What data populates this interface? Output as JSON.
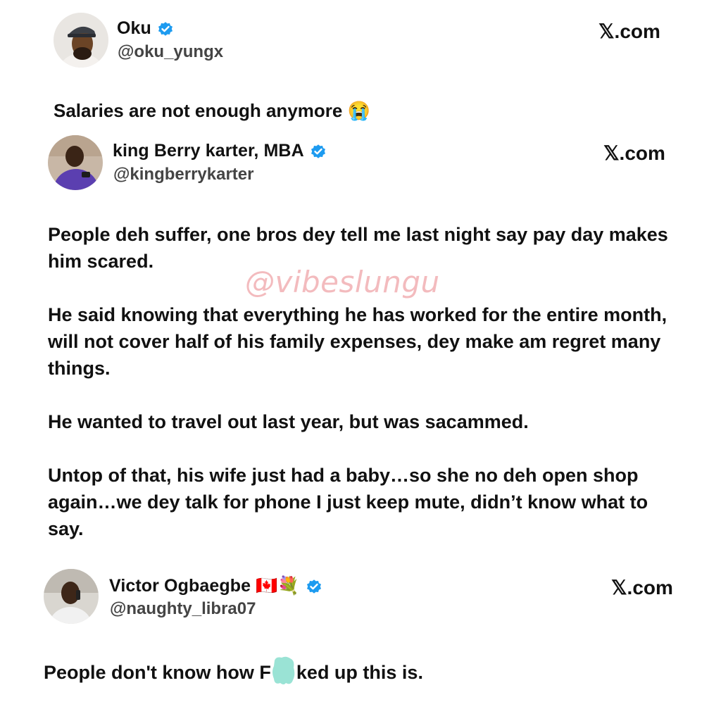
{
  "tweets": [
    {
      "name": "Oku",
      "handle": "@oku_yungx",
      "source": "𝕏.com",
      "text": "Salaries are not enough anymore 😭",
      "avatar_icon": "man-with-cap-avatar"
    },
    {
      "name": "king Berry karter, MBA",
      "handle": "@kingberrykarter",
      "source": "𝕏.com",
      "paragraphs": [
        "People deh suffer, one bros dey tell me last night say pay day makes him scared.",
        "He said knowing that everything he has worked for the entire month, will not cover half of his family expenses, dey make am regret many things.",
        "He wanted to travel out last year,  but was sacammed.",
        "Untop of that, his wife just had a baby…so she no deh open shop again…we dey talk for phone I just keep mute, didn’t know what to say."
      ],
      "avatar_icon": "man-in-purple-avatar"
    },
    {
      "name": "Victor Ogbaegbe 🇨🇦💐",
      "handle": "@naughty_libra07",
      "source": "𝕏.com",
      "text_before": "People don't know how F",
      "text_after": "ked up this is.",
      "avatar_icon": "man-on-phone-avatar"
    }
  ],
  "watermark": "@vibeslungu",
  "colors": {
    "verified_blue": "#1d9bf0",
    "watermark_pink": "#f2b0b3",
    "censor_teal": "#8fe0d0"
  }
}
